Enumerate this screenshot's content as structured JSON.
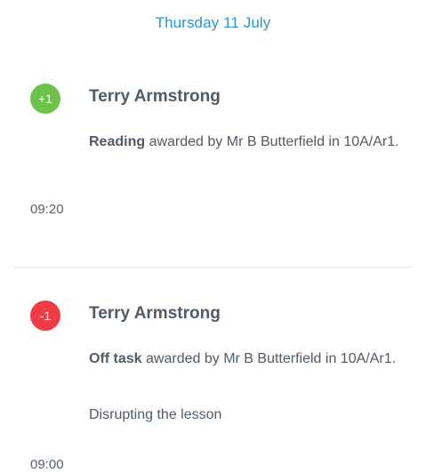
{
  "date_header": "Thursday 11 July",
  "events": [
    {
      "badge": "+1",
      "badge_color": "#6cc24a",
      "student": "Terry Armstrong",
      "behaviour": "Reading",
      "awarded_text": " awarded by Mr B Butterfield in 10A/Ar1.",
      "time": "09:20"
    },
    {
      "badge": "-1",
      "badge_color": "#ee3b45",
      "student": "Terry Armstrong",
      "behaviour": "Off task",
      "awarded_text": " awarded by Mr B Butterfield in 10A/Ar1.",
      "note": "Disrupting the lesson",
      "time": "09:00"
    }
  ]
}
